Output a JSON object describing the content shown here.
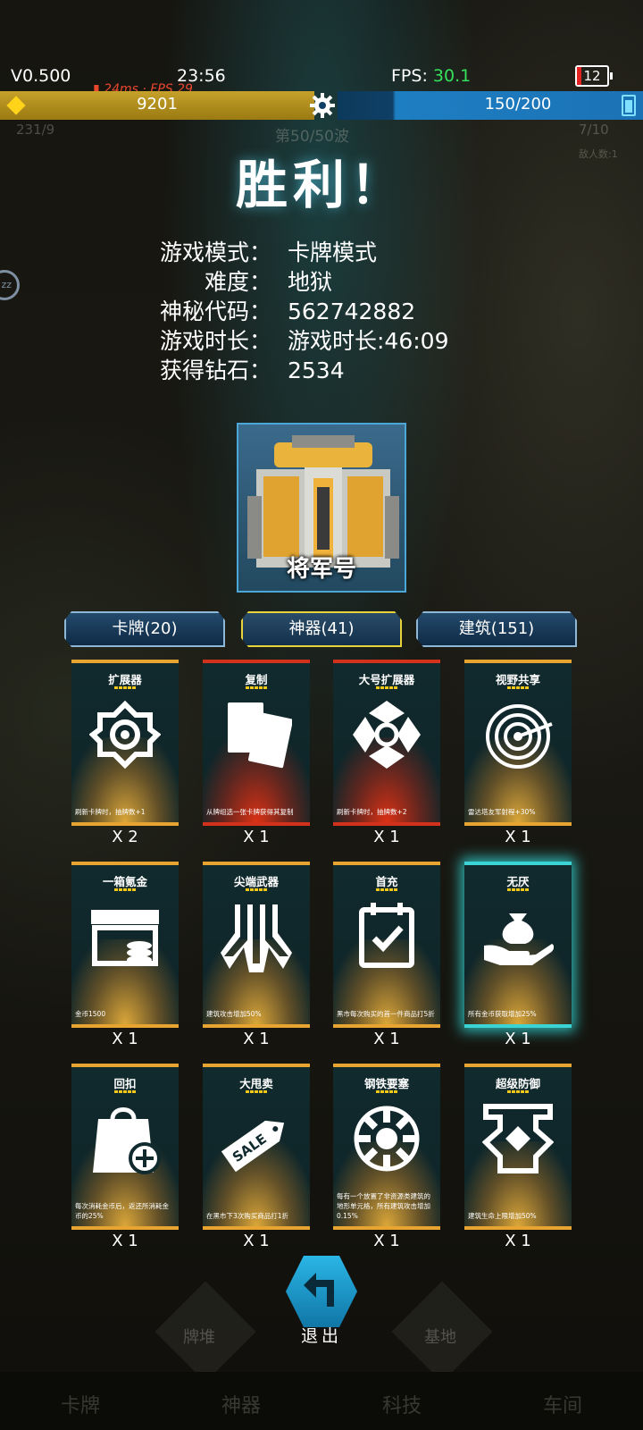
{
  "status": {
    "version": "V0.500",
    "time": "23:56",
    "fps_label": "FPS: ",
    "fps_value": "30.1",
    "battery": "12",
    "ping": "24ms · FPS 29"
  },
  "resources": {
    "gold": "9201",
    "energy": "150/200"
  },
  "background": {
    "left_count": "231/9",
    "wave": "第50/50波",
    "right_count": "7/10",
    "enemy": "敌人数:1"
  },
  "result": {
    "title": "胜利！",
    "rows": [
      {
        "label": "游戏模式：",
        "value": "卡牌模式"
      },
      {
        "label": "难度：",
        "value": "地狱"
      },
      {
        "label": "神秘代码：",
        "value": "562742882"
      },
      {
        "label": "游戏时长：",
        "value": "游戏时长:46:09"
      },
      {
        "label": "获得钻石：",
        "value": "2534"
      }
    ]
  },
  "hero": {
    "name": "将军号"
  },
  "tabs": [
    {
      "label": "卡牌(20)",
      "active": false
    },
    {
      "label": "神器(41)",
      "active": true
    },
    {
      "label": "建筑(151)",
      "active": false
    }
  ],
  "cards": [
    {
      "title": "扩展器",
      "desc": "刷新卡牌时，抽牌数+1",
      "count": "X 2",
      "icon": "expander-icon",
      "color": "gold"
    },
    {
      "title": "复制",
      "desc": "从牌组选一张卡牌获得其复制",
      "count": "X 1",
      "icon": "copy-cards-icon",
      "color": "red"
    },
    {
      "title": "大号扩展器",
      "desc": "刷新卡牌时，抽牌数+2",
      "count": "X 1",
      "icon": "large-expander-icon",
      "color": "red"
    },
    {
      "title": "视野共享",
      "desc": "雷达塔友军射程+30%",
      "count": "X 1",
      "icon": "radar-icon",
      "color": "gold"
    },
    {
      "title": "一箱氪金",
      "desc": "金币1500",
      "count": "X 1",
      "icon": "treasure-chest-icon",
      "color": "gold"
    },
    {
      "title": "尖端武器",
      "desc": "建筑攻击增加50%",
      "count": "X 1",
      "icon": "weapon-icon",
      "color": "gold"
    },
    {
      "title": "首充",
      "desc": "黑市每次购买的首一件商品打5折",
      "count": "X 1",
      "icon": "calendar-check-icon",
      "color": "gold"
    },
    {
      "title": "无厌",
      "desc": "所有金币获取增加25%",
      "count": "X 1",
      "icon": "money-bag-hand-icon",
      "color": "gold"
    },
    {
      "title": "回扣",
      "desc": "每次消耗金币后，返还所消耗金币的25%",
      "count": "X 1",
      "icon": "shopping-bag-plus-icon",
      "color": "gold"
    },
    {
      "title": "大甩卖",
      "desc": "在黑市下3次购买商品打1折",
      "count": "X 1",
      "icon": "sale-tag-icon",
      "color": "gold"
    },
    {
      "title": "钢铁要塞",
      "desc": "每有一个放置了非资源类建筑的地形单元格，所有建筑攻击增加0.15%",
      "count": "X 1",
      "icon": "fortress-icon",
      "color": "gold"
    },
    {
      "title": "超级防御",
      "desc": "建筑生命上限增加50%",
      "count": "X 1",
      "icon": "defense-icon",
      "color": "gold"
    }
  ],
  "sale_text": "SALE",
  "exit": {
    "label": "退出"
  },
  "bottom_nav": [
    "卡牌",
    "神器",
    "科技",
    "车间"
  ],
  "ghost_nav": [
    "牌堆",
    "基地"
  ]
}
